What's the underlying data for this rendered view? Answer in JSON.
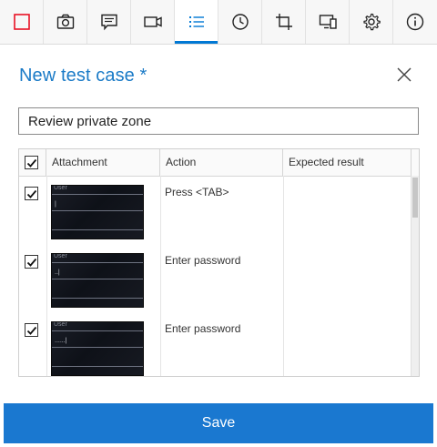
{
  "toolbar": {
    "tools": [
      {
        "icon": "stop-record-icon",
        "color": "#e81123"
      },
      {
        "icon": "camera-icon"
      },
      {
        "icon": "note-icon"
      },
      {
        "icon": "video-icon"
      },
      {
        "icon": "list-icon",
        "active": true
      },
      {
        "icon": "clock-icon"
      },
      {
        "icon": "crop-icon"
      },
      {
        "icon": "device-icon"
      },
      {
        "icon": "gear-icon"
      },
      {
        "icon": "info-icon"
      }
    ],
    "accent": "#0078d4"
  },
  "dialog": {
    "title": "New test case *",
    "name_value": "Review private zone"
  },
  "grid": {
    "columns": [
      "Attachment",
      "Action",
      "Expected result"
    ],
    "select_all_checked": true,
    "rows": [
      {
        "checked": true,
        "thumb_label": "User",
        "thumb_text": "|",
        "action": "Press <TAB>",
        "expected": ""
      },
      {
        "checked": true,
        "thumb_label": "User",
        "thumb_text": "..|",
        "action": "Enter password",
        "expected": ""
      },
      {
        "checked": true,
        "thumb_label": "User",
        "thumb_text": "......|",
        "action": "Enter password",
        "expected": ""
      }
    ]
  },
  "save_label": "Save",
  "colors": {
    "title": "#1b7bc7",
    "save_button": "#1a78d0"
  }
}
